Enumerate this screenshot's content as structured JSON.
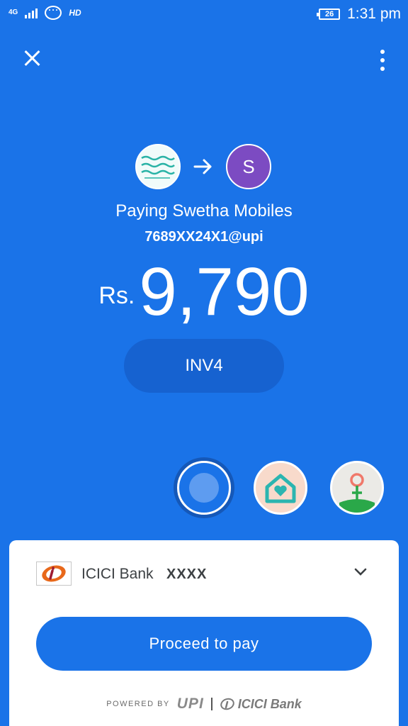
{
  "status_bar": {
    "network": "4G",
    "hd": "HD",
    "battery": "26",
    "time": "1:31 pm"
  },
  "payee": {
    "initial": "S",
    "name_line": "Paying Swetha Mobiles",
    "upi_id": "7689XX24X1@upi"
  },
  "payment": {
    "currency": "Rs.",
    "amount": "9,790",
    "note": "INV4"
  },
  "themes": [
    {
      "icon": "blue-circle-icon",
      "selected": true
    },
    {
      "icon": "home-heart-icon",
      "selected": false
    },
    {
      "icon": "flower-icon",
      "selected": false
    }
  ],
  "bank": {
    "name": "ICICI Bank",
    "account": "XXXX"
  },
  "actions": {
    "proceed_label": "Proceed to pay"
  },
  "footer": {
    "powered_by": "POWERED BY",
    "upi": "UPI",
    "bank_brand": "ICICI Bank"
  },
  "colors": {
    "background": "#1a73e8",
    "note_pill": "#1662d0",
    "payee_avatar": "#7c4bc2",
    "sheet": "#ffffff"
  }
}
